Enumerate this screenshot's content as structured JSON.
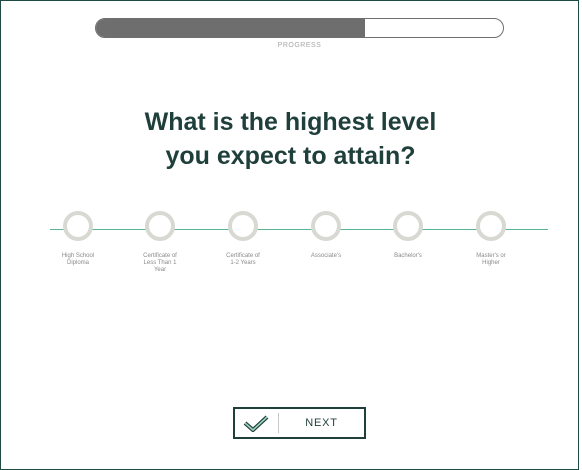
{
  "progress": {
    "label": "PROGRESS",
    "fraction": 0.66
  },
  "question": {
    "line1": "What is the highest level",
    "line2": "you expect to attain?"
  },
  "options": [
    {
      "lines": [
        "High School",
        "Diploma",
        ""
      ]
    },
    {
      "lines": [
        "Certificate of",
        "Less Than 1",
        "Year"
      ]
    },
    {
      "lines": [
        "Certificate of",
        "1-2 Years",
        ""
      ]
    },
    {
      "lines": [
        "Associate's",
        "",
        ""
      ]
    },
    {
      "lines": [
        "Bachelor's",
        "",
        ""
      ]
    },
    {
      "lines": [
        "Master's or",
        "Higher",
        ""
      ]
    }
  ],
  "next_button": {
    "label": "NEXT",
    "icon": "check-icon"
  },
  "colors": {
    "accent_green": "#5bb594",
    "dark_teal": "#1f3f3b",
    "circle_border": "#d9d9d3",
    "progress_fill": "#6e6e6e"
  }
}
